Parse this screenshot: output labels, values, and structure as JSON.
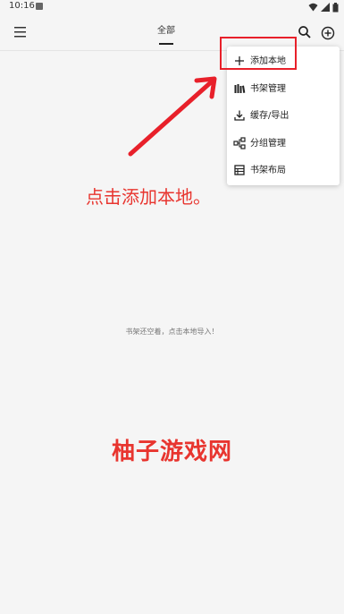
{
  "status_bar": {
    "time": "10:16"
  },
  "tabs": [
    {
      "label": "全部"
    }
  ],
  "menu": {
    "items": [
      {
        "label": "添加本地",
        "icon": "plus-icon"
      },
      {
        "label": "书架管理",
        "icon": "bookshelf-icon"
      },
      {
        "label": "缓存/导出",
        "icon": "download-icon"
      },
      {
        "label": "分组管理",
        "icon": "group-icon"
      },
      {
        "label": "书架布局",
        "icon": "layout-icon"
      }
    ]
  },
  "annotation": "点击添加本地。",
  "empty_hint": "书架还空着，点击本地导入！",
  "watermark": "柚子游戏网",
  "colors": {
    "highlight": "#e8202a",
    "annotation_red": "#e8352f",
    "background": "#f5f5f5"
  }
}
